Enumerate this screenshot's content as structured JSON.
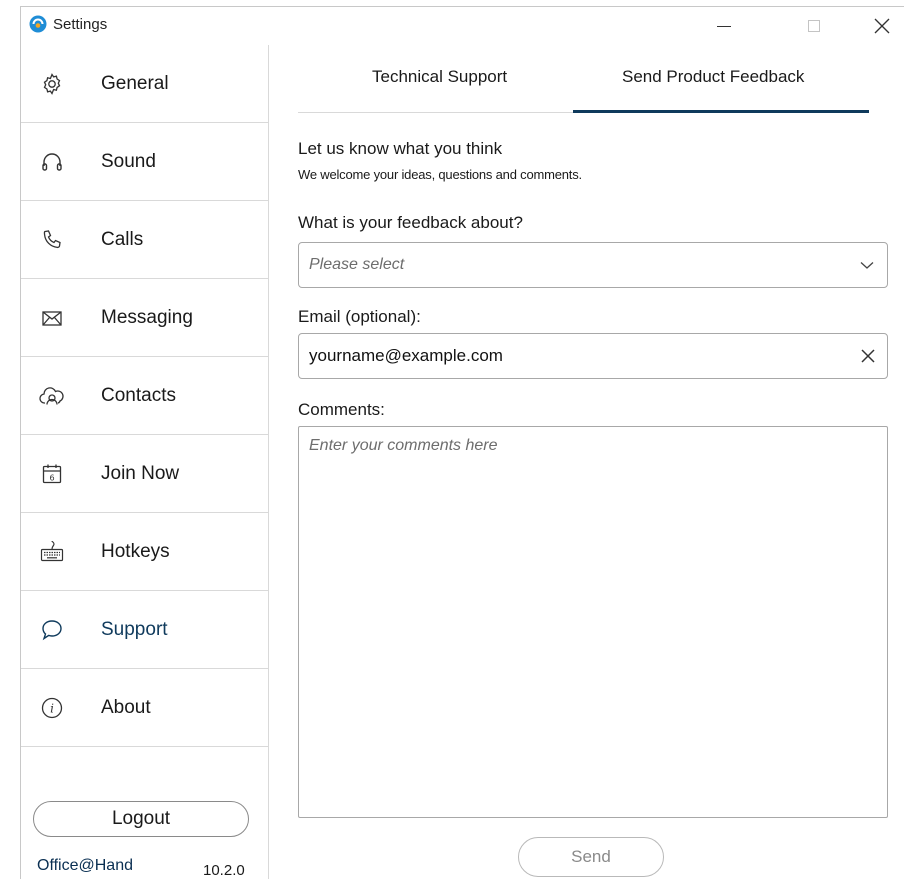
{
  "window": {
    "title": "Settings",
    "controls": {
      "minimize": "minimize",
      "maximize": "maximize",
      "close": "close"
    }
  },
  "sidebar": {
    "items": [
      {
        "label": "General",
        "icon": "gear-icon"
      },
      {
        "label": "Sound",
        "icon": "headphones-icon"
      },
      {
        "label": "Calls",
        "icon": "phone-icon"
      },
      {
        "label": "Messaging",
        "icon": "envelope-icon"
      },
      {
        "label": "Contacts",
        "icon": "contacts-cloud-icon"
      },
      {
        "label": "Join Now",
        "icon": "calendar-icon"
      },
      {
        "label": "Hotkeys",
        "icon": "keyboard-icon"
      },
      {
        "label": "Support",
        "icon": "chat-bubble-icon"
      },
      {
        "label": "About",
        "icon": "info-icon"
      }
    ],
    "active": "Support",
    "logout_label": "Logout",
    "brand": "Office@Hand",
    "version": "10.2.0"
  },
  "tabs": [
    {
      "label": "Technical Support",
      "active": false
    },
    {
      "label": "Send Product Feedback",
      "active": true
    }
  ],
  "form": {
    "heading": "Let us know what you think",
    "subheading": "We welcome your ideas, questions and comments.",
    "about_label": "What is your feedback about?",
    "about_placeholder": "Please select",
    "email_label": "Email (optional):",
    "email_value": "yourname@example.com",
    "comments_label": "Comments:",
    "comments_placeholder": "Enter your comments here",
    "send_label": "Send"
  },
  "colors": {
    "accent": "#0f3a5c",
    "border": "#a8a8a8",
    "divider": "#d9d9d9",
    "placeholder": "#6d6d6d"
  }
}
